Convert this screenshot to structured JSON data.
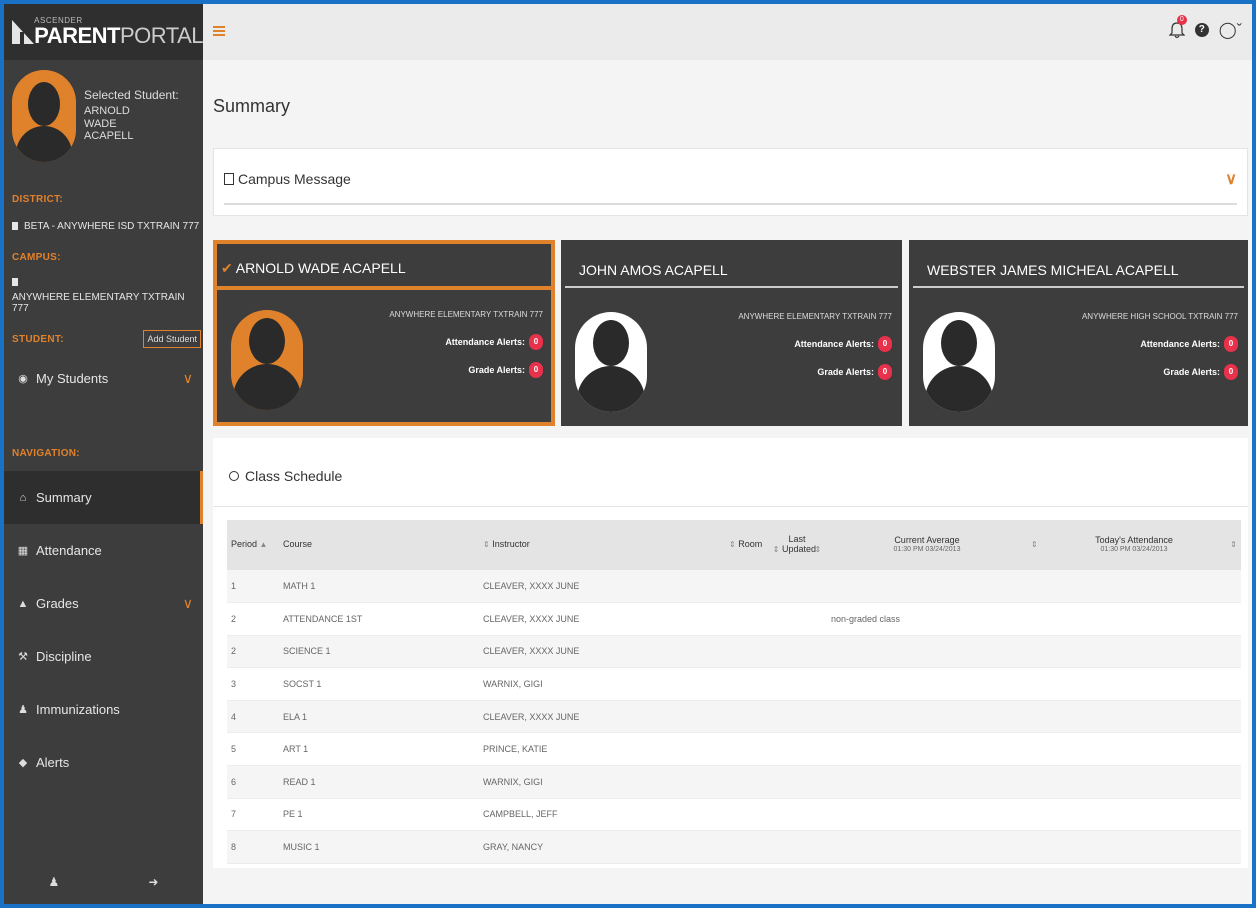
{
  "brand": {
    "small": "ASCENDER",
    "bold": "PARENT",
    "light": "PORTAL"
  },
  "selected_student": {
    "label": "Selected Student:",
    "name": "ARNOLD WADE ACAPELL"
  },
  "sidebar": {
    "district_label": "DISTRICT:",
    "district_value": "BETA - ANYWHERE ISD TXTRAIN 777",
    "campus_label": "CAMPUS:",
    "campus_value": "ANYWHERE ELEMENTARY TXTRAIN 777",
    "student_label": "STUDENT:",
    "add_student": "Add Student",
    "my_students": "My Students",
    "navigation_label": "NAVIGATION:",
    "nav": [
      {
        "label": "Summary",
        "icon": "home-icon"
      },
      {
        "label": "Attendance",
        "icon": "calendar-icon"
      },
      {
        "label": "Grades",
        "icon": "graduation-cap-icon"
      },
      {
        "label": "Discipline",
        "icon": "gavel-icon"
      },
      {
        "label": "Immunizations",
        "icon": "user-md-icon"
      },
      {
        "label": "Alerts",
        "icon": "bell-icon"
      }
    ]
  },
  "topbar": {
    "bell_badge": "0"
  },
  "page": {
    "title": "Summary"
  },
  "campus_message": {
    "title": "Campus Message"
  },
  "students": [
    {
      "name": "ARNOLD WADE ACAPELL",
      "campus": "ANYWHERE ELEMENTARY TXTRAIN 777",
      "attendance_label": "Attendance Alerts:",
      "attendance_count": "0",
      "grade_label": "Grade Alerts:",
      "grade_count": "0"
    },
    {
      "name": "JOHN AMOS ACAPELL",
      "campus": "ANYWHERE ELEMENTARY TXTRAIN 777",
      "attendance_label": "Attendance Alerts:",
      "attendance_count": "0",
      "grade_label": "Grade Alerts:",
      "grade_count": "0"
    },
    {
      "name": "WEBSTER JAMES MICHEAL ACAPELL",
      "campus": "ANYWHERE HIGH SCHOOL TXTRAIN 777",
      "attendance_label": "Attendance Alerts:",
      "attendance_count": "0",
      "grade_label": "Grade Alerts:",
      "grade_count": "0"
    }
  ],
  "schedule": {
    "title": "Class Schedule",
    "columns": {
      "period": "Period",
      "course": "Course",
      "instructor": "Instructor",
      "room": "Room",
      "last_updated": "Last Updated",
      "current_average": "Current Average",
      "current_average_sub": "01:30 PM 03/24/2013",
      "todays_attendance": "Today's Attendance",
      "todays_attendance_sub": "01:30 PM 03/24/2013"
    },
    "rows": [
      {
        "period": "1",
        "course": "MATH 1",
        "instructor": "CLEAVER, XXXX JUNE",
        "note": ""
      },
      {
        "period": "2",
        "course": "ATTENDANCE 1ST",
        "instructor": "CLEAVER, XXXX JUNE",
        "note": "non-graded class"
      },
      {
        "period": "2",
        "course": "SCIENCE 1",
        "instructor": "CLEAVER, XXXX JUNE",
        "note": ""
      },
      {
        "period": "3",
        "course": "SOCST 1",
        "instructor": "WARNIX, GIGI",
        "note": ""
      },
      {
        "period": "4",
        "course": "ELA 1",
        "instructor": "CLEAVER, XXXX JUNE",
        "note": ""
      },
      {
        "period": "5",
        "course": "ART 1",
        "instructor": "PRINCE, KATIE",
        "note": ""
      },
      {
        "period": "6",
        "course": "READ 1",
        "instructor": "WARNIX, GIGI",
        "note": ""
      },
      {
        "period": "7",
        "course": "PE 1",
        "instructor": "CAMPBELL, JEFF",
        "note": ""
      },
      {
        "period": "8",
        "course": "MUSIC 1",
        "instructor": "GRAY, NANCY",
        "note": ""
      }
    ]
  },
  "colors": {
    "accent": "#e0822c",
    "sidebar": "#3d3d3d",
    "badge": "#e8314a",
    "frame": "#1a72c6"
  }
}
